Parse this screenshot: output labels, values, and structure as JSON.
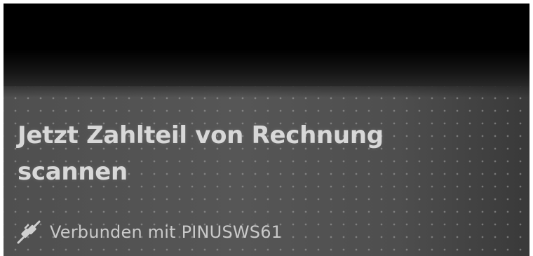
{
  "scan_prompt": {
    "title_line1": "Jetzt Zahlteil von Rechnung",
    "title_line2": "scannen"
  },
  "connection": {
    "status_text": "Verbunden mit PINUSWS61",
    "icon": "plug-connected-icon"
  },
  "colors": {
    "top_background": "#000000",
    "panel_background": "#525252",
    "text": "#d8d8d8"
  }
}
